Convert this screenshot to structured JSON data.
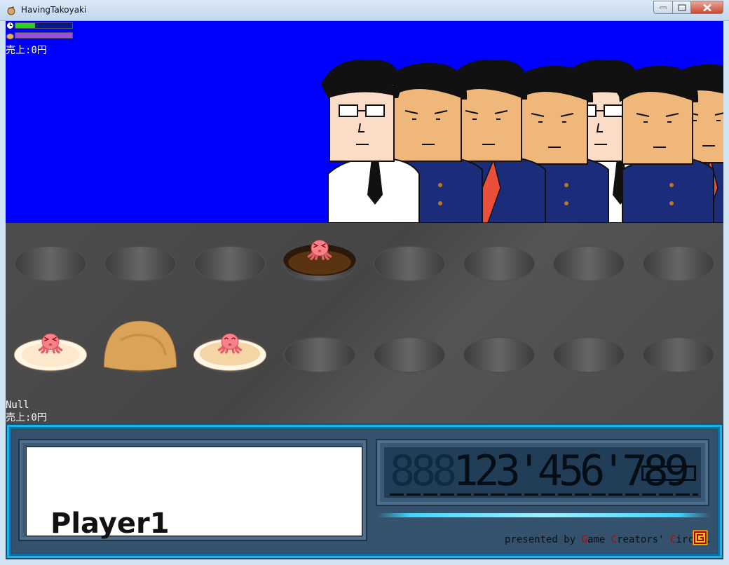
{
  "window": {
    "title": "HavingTakoyaki",
    "icon": "takoyaki-app-icon"
  },
  "hud": {
    "timer_icon": "clock-icon",
    "timer_level": 0.35,
    "timer_color": "#2bd11f",
    "gauge_icon": "takoyaki-icon",
    "gauge_level": 1.0,
    "gauge_color": "#9a4fe0",
    "top_sales": "売上:0円",
    "status": "Null",
    "bottom_sales": "売上:0円"
  },
  "colors": {
    "sky": "#0000ff",
    "frame_accent": "#16b3ec"
  },
  "customers": [
    {
      "type": "glasses-white-shirt"
    },
    {
      "type": "blue-uniform"
    },
    {
      "type": "red-jacket"
    },
    {
      "type": "glasses-white-shirt"
    },
    {
      "type": "blue-uniform"
    },
    {
      "type": "glasses-white-shirt"
    },
    {
      "type": "blue-uniform"
    },
    {
      "type": "red-jacket"
    }
  ],
  "grill": {
    "top_row": [
      "empty",
      "empty",
      "empty",
      "cooking-octopus",
      "empty",
      "empty",
      "empty",
      "empty"
    ],
    "bottom_row": [
      "batter-octopus",
      "cooked-ball",
      "batter-octopus-happy",
      "empty",
      "empty",
      "empty",
      "empty",
      "empty"
    ]
  },
  "panel": {
    "player_name": "Player1",
    "score_dim": "888",
    "score_digits": "123'456'789",
    "credit_prefix": "presented by ",
    "credit_g": "G",
    "credit_ame": "ame ",
    "credit_c1": "C",
    "credit_reators": "reators' ",
    "credit_c2": "C",
    "credit_ircle": "ircle.",
    "logo_icon": "gcc-logo-icon"
  }
}
